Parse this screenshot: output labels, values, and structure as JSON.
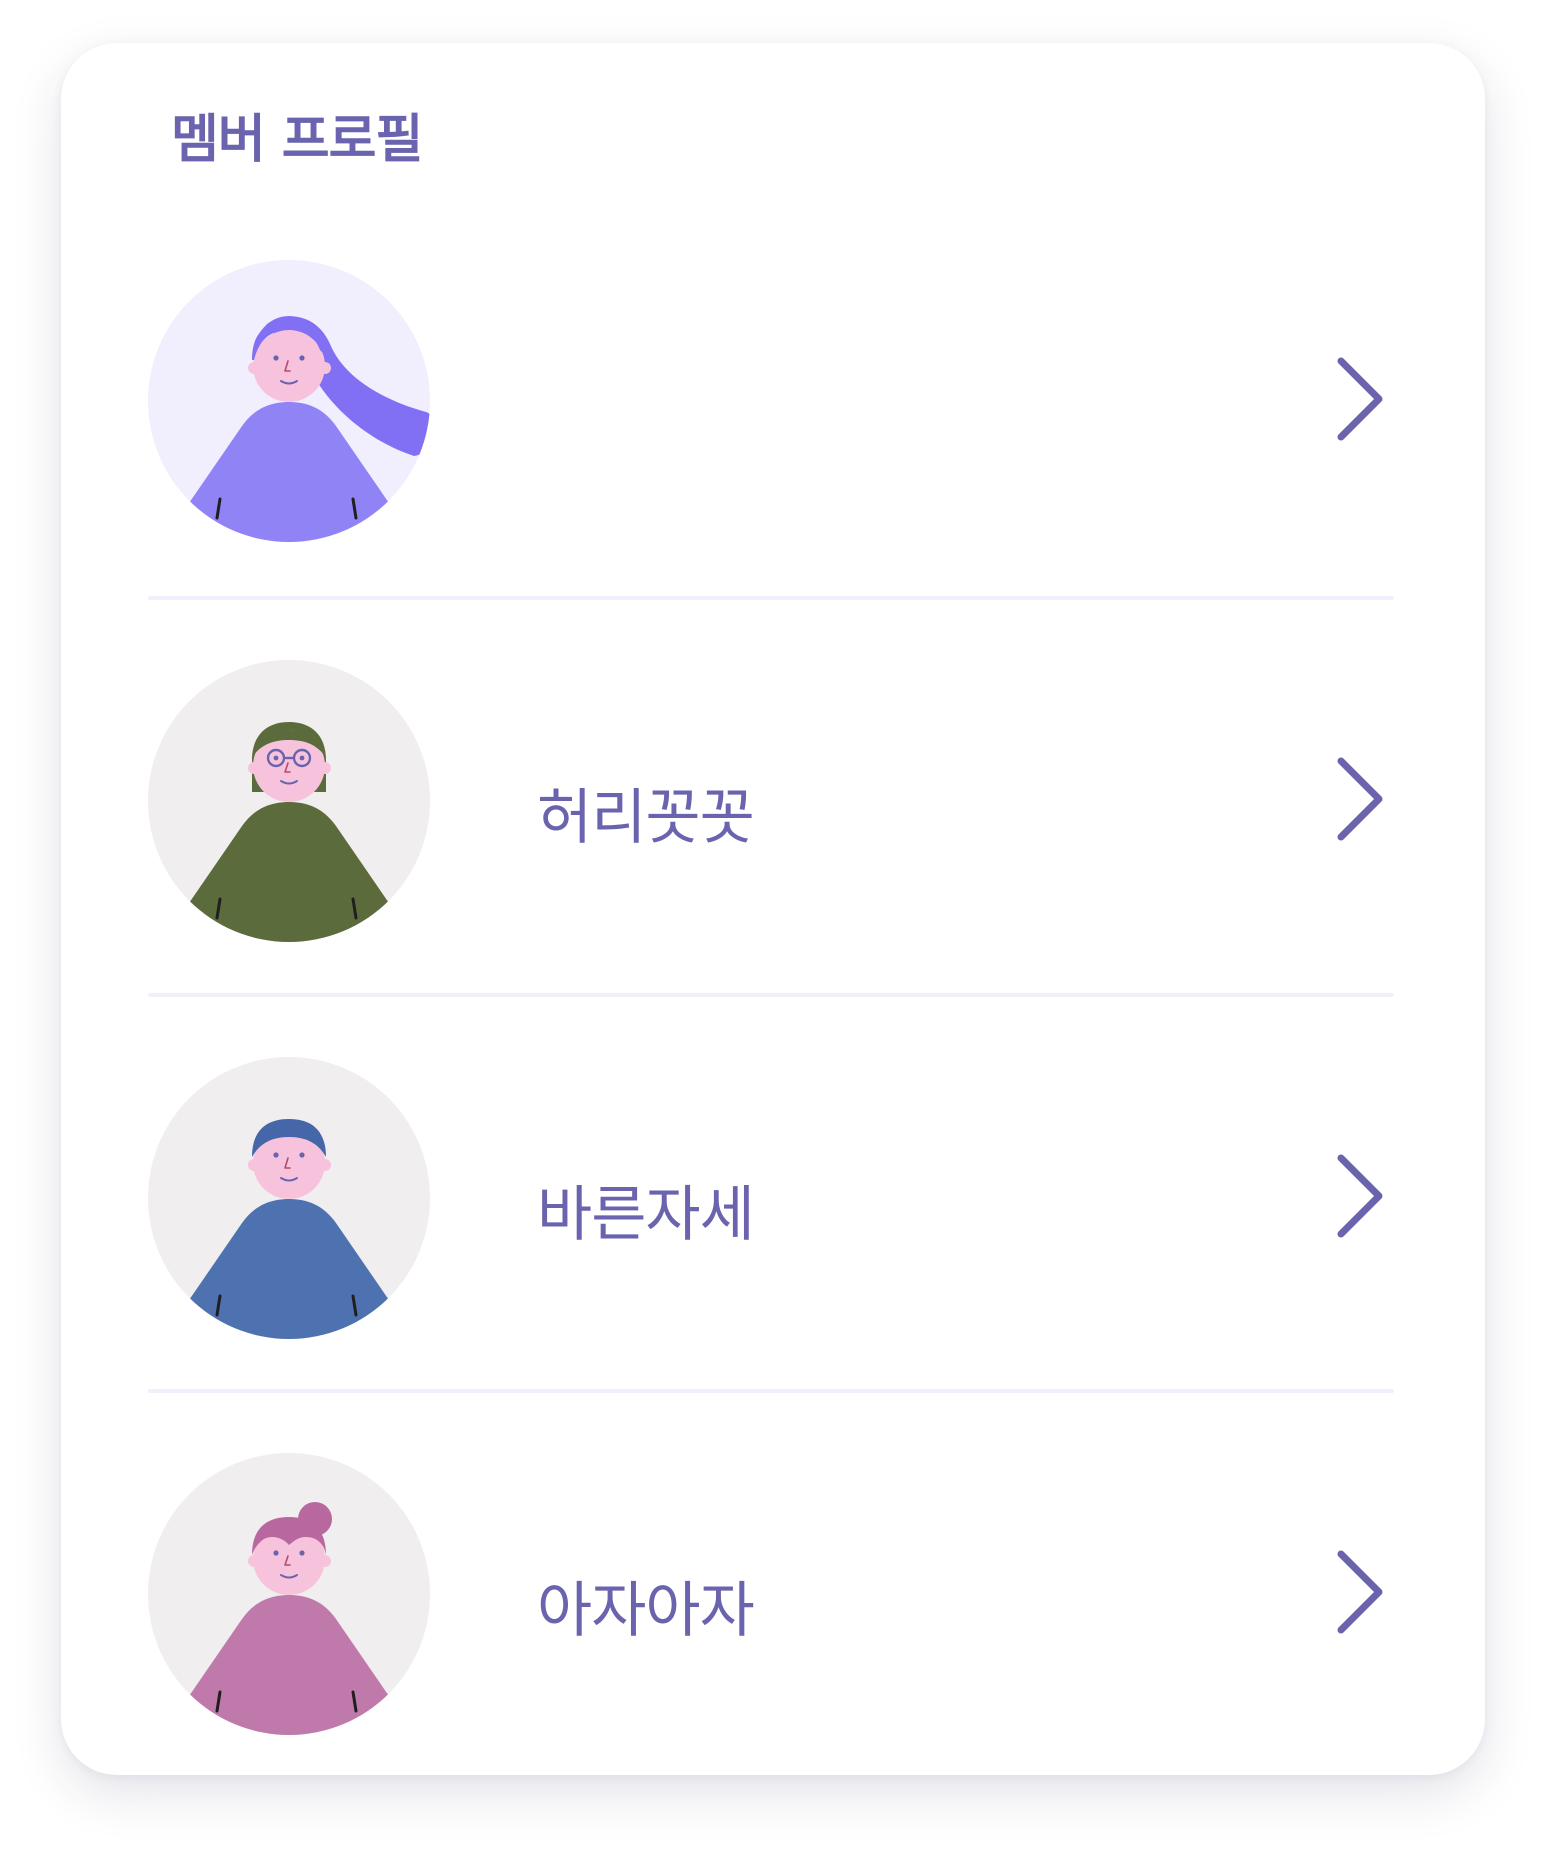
{
  "profiles_card": {
    "title": "멤버 프로필",
    "members": [
      {
        "name": "",
        "avatar_icon": "long-hair-woman-avatar-icon",
        "bg_color": "#f1eefd",
        "body_color": "#8f83f6",
        "hair_color": "#8170f3",
        "glasses": false,
        "chevron_icon": "chevron-right-icon"
      },
      {
        "name": "허리꼿꼿",
        "avatar_icon": "glasses-avatar-icon",
        "bg_color": "#f0eeef",
        "body_color": "#5c6b3c",
        "hair_color": "#5c6b3c",
        "glasses": true,
        "chevron_icon": "chevron-right-icon"
      },
      {
        "name": "바른자세",
        "avatar_icon": "short-hair-avatar-icon",
        "bg_color": "#f0eeef",
        "body_color": "#4e72b0",
        "hair_color": "#4566a8",
        "glasses": false,
        "chevron_icon": "chevron-right-icon"
      },
      {
        "name": "아자아자",
        "avatar_icon": "hair-bun-avatar-icon",
        "bg_color": "#f0eeef",
        "body_color": "#bf7aab",
        "hair_color": "#b8689f",
        "glasses": false,
        "chevron_icon": "chevron-right-icon"
      }
    ]
  },
  "colors": {
    "accent": "#6a63ad",
    "divider": "#f1effb",
    "skin": "#f7c3dc",
    "eyes": "#6a63ad",
    "mouth": "#6a63ad"
  }
}
